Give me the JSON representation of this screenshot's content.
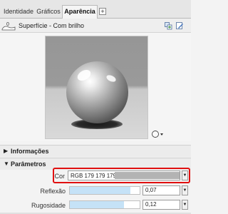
{
  "tabs": [
    {
      "label": "Identidade",
      "active": false
    },
    {
      "label": "Gráficos",
      "active": false
    },
    {
      "label": "Aparência",
      "active": true
    }
  ],
  "add_tab_label": "+",
  "material": {
    "name": "Superfície - Com brilho",
    "icon": "material-swatch-icon",
    "badge": "0"
  },
  "header_icons": [
    "replace-material-icon",
    "edit-material-icon"
  ],
  "preview": {
    "view_control_icon": "sphere-view-icon"
  },
  "sections": [
    {
      "label": "Informações",
      "expanded": false
    },
    {
      "label": "Parâmetros",
      "expanded": true
    }
  ],
  "parameters": {
    "cor": {
      "label": "Cor",
      "value": "RGB 179 179 179",
      "swatch_color": "#b3b3b3"
    },
    "reflexao": {
      "label": "Reflexão",
      "value": "0,07",
      "level": 0.87
    },
    "rugosidade": {
      "label": "Rugosidade",
      "value": "0,12",
      "level": 0.78
    }
  },
  "colors": {
    "highlight_border": "#e01010",
    "slider_fill": "#c5e2f7"
  }
}
